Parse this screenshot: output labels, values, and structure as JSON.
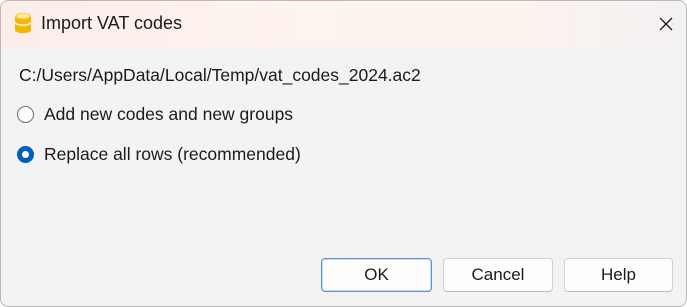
{
  "window": {
    "title": "Import VAT codes",
    "app_icon": "database-cylinder-icon",
    "close_icon": "close-icon"
  },
  "file_path": "C:/Users/AppData/Local/Temp/vat_codes_2024.ac2",
  "options": [
    {
      "label": "Add new codes and new groups",
      "selected": false
    },
    {
      "label": "Replace all rows (recommended)",
      "selected": true
    }
  ],
  "buttons": {
    "ok": "OK",
    "cancel": "Cancel",
    "help": "Help"
  },
  "colors": {
    "accent": "#005fb8",
    "icon_yellow": "#f5c518"
  }
}
